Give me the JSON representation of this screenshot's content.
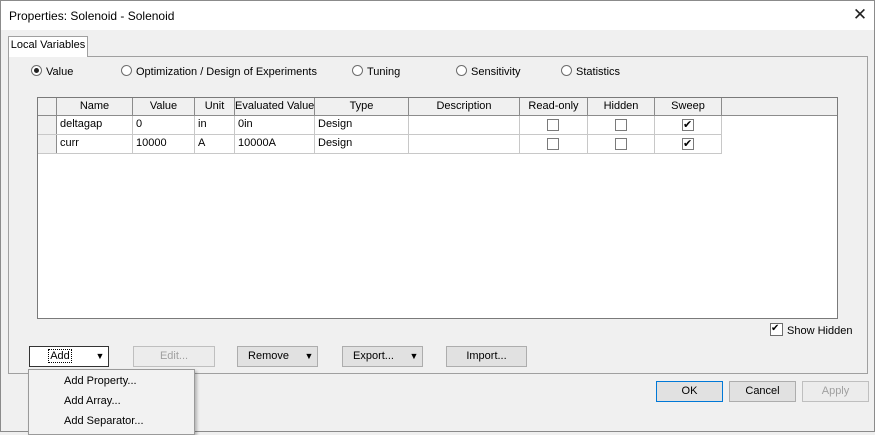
{
  "window": {
    "title": "Properties: Solenoid - Solenoid",
    "close_glyph": "✕"
  },
  "tabs": [
    {
      "label": "Local Variables"
    }
  ],
  "radio_options": [
    {
      "label": "Value",
      "checked": true
    },
    {
      "label": "Optimization / Design of Experiments",
      "checked": false
    },
    {
      "label": "Tuning",
      "checked": false
    },
    {
      "label": "Sensitivity",
      "checked": false
    },
    {
      "label": "Statistics",
      "checked": false
    }
  ],
  "table": {
    "columns": [
      "Name",
      "Value",
      "Unit",
      "Evaluated Value",
      "Type",
      "Description",
      "Read-only",
      "Hidden",
      "Sweep"
    ],
    "rows": [
      {
        "name": "deltagap",
        "value": "0",
        "unit": "in",
        "evaluated": "0in",
        "type": "Design",
        "description": "",
        "read_only": false,
        "hidden": false,
        "sweep": true
      },
      {
        "name": "curr",
        "value": "10000",
        "unit": "A",
        "evaluated": "10000A",
        "type": "Design",
        "description": "",
        "read_only": false,
        "hidden": false,
        "sweep": true
      }
    ]
  },
  "show_hidden": {
    "label": "Show Hidden",
    "checked": true
  },
  "buttons": {
    "add": "Add",
    "edit": "Edit...",
    "remove": "Remove",
    "export": "Export...",
    "import": "Import...",
    "ok": "OK",
    "cancel": "Cancel",
    "apply": "Apply"
  },
  "add_menu": [
    "Add Property...",
    "Add Array...",
    "Add Separator..."
  ],
  "icons": {
    "dropdown_arrow": "chevron-down-icon",
    "close": "close-icon"
  }
}
